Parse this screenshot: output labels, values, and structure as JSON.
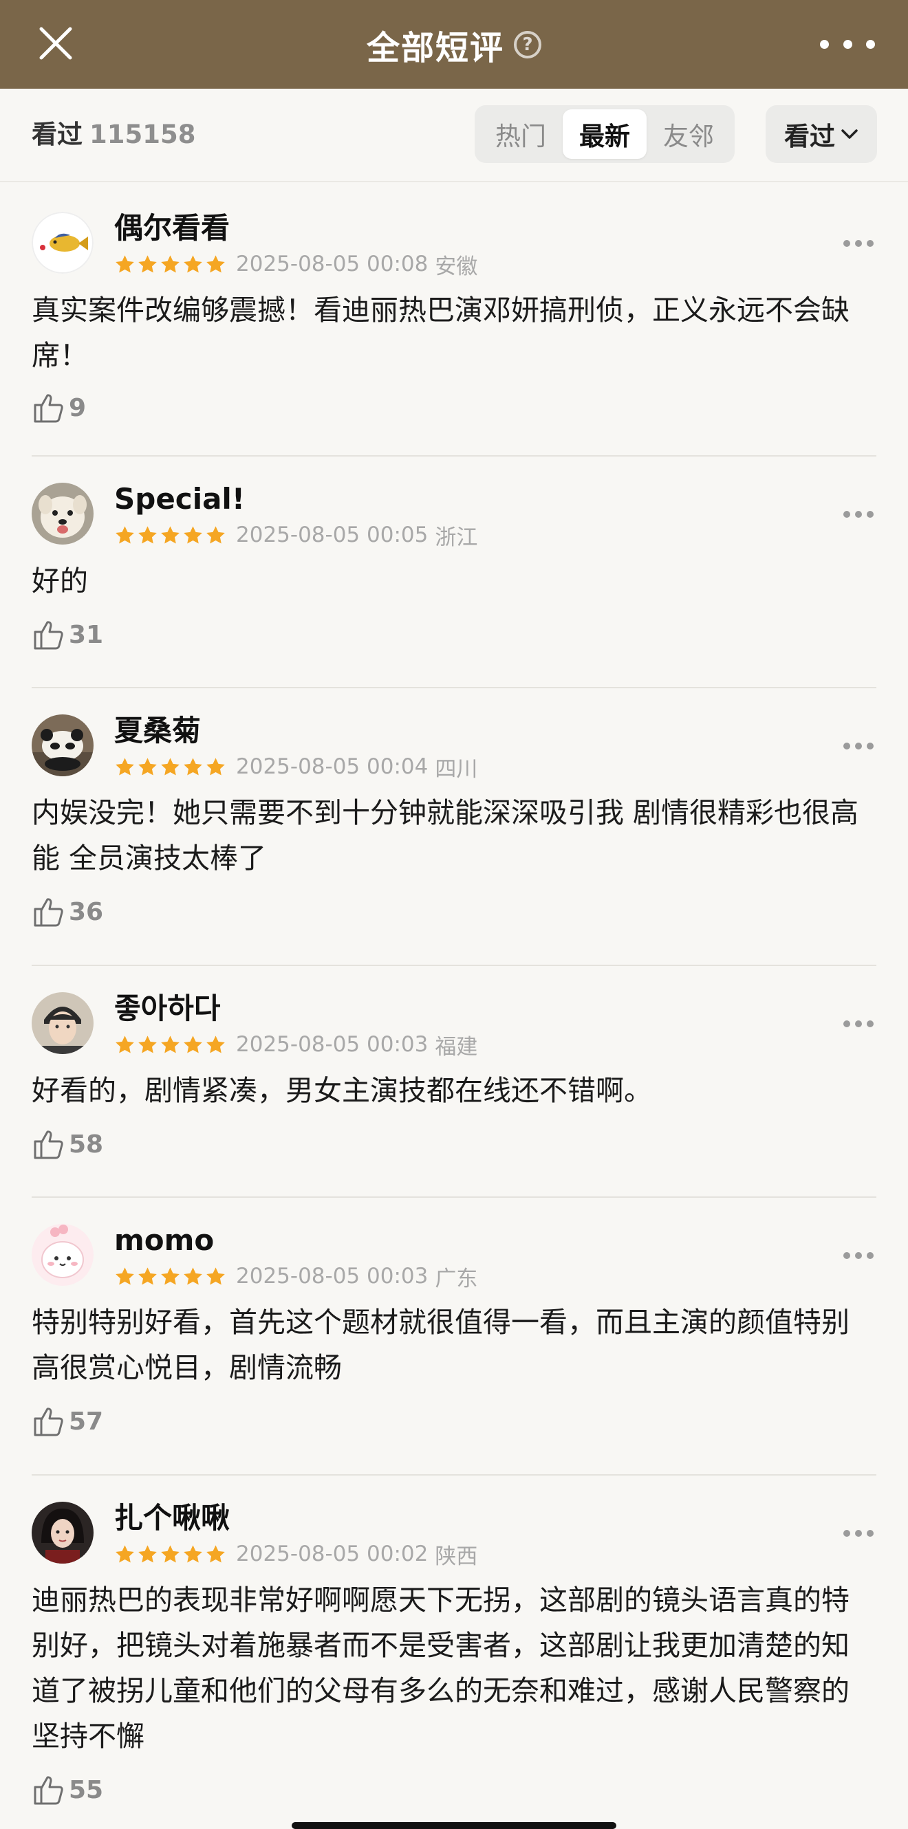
{
  "header": {
    "title": "全部短评",
    "help_glyph": "?",
    "close_icon": "close-icon",
    "more_icon": "more-horizontal-icon"
  },
  "filter": {
    "seen_label": "看过",
    "seen_count": "115158",
    "tabs": [
      {
        "label": "热门",
        "active": false
      },
      {
        "label": "最新",
        "active": true
      },
      {
        "label": "友邻",
        "active": false
      }
    ],
    "dropdown_label": "看过",
    "dropdown_icon": "chevron-down-icon"
  },
  "colors": {
    "header_bg": "#7a6649",
    "star": "#f5a623",
    "background": "#f8f7f4"
  },
  "comments": [
    {
      "user": "偶尔看看",
      "rating": 5,
      "date": "2025-08-05 00:08",
      "location": "安徽",
      "text": "真实案件改编够震撼！看迪丽热巴演邓妍搞刑侦，正义永远不会缺席！",
      "likes": "9",
      "avatar_icon": "fish-avatar"
    },
    {
      "user": "Special!",
      "rating": 5,
      "date": "2025-08-05 00:05",
      "location": "浙江",
      "text": "好的",
      "likes": "31",
      "avatar_icon": "dog-avatar"
    },
    {
      "user": "夏桑菊",
      "rating": 5,
      "date": "2025-08-05 00:04",
      "location": "四川",
      "text": "内娱没完！她只需要不到十分钟就能深深吸引我 剧情很精彩也很高能 全员演技太棒了",
      "likes": "36",
      "avatar_icon": "panda-avatar"
    },
    {
      "user": "좋아하다",
      "rating": 5,
      "date": "2025-08-05 00:03",
      "location": "福建",
      "text": "好看的，剧情紧凑，男女主演技都在线还不错啊。",
      "likes": "58",
      "avatar_icon": "person-avatar"
    },
    {
      "user": "momo",
      "rating": 5,
      "date": "2025-08-05 00:03",
      "location": "广东",
      "text": "特别特别好看，首先这个题材就很值得一看，而且主演的颜值特别高很赏心悦目，剧情流畅",
      "likes": "57",
      "avatar_icon": "cartoon-avatar"
    },
    {
      "user": "扎个啾啾",
      "rating": 5,
      "date": "2025-08-05 00:02",
      "location": "陕西",
      "text": "迪丽热巴的表现非常好啊啊愿天下无拐，这部剧的镜头语言真的特别好，把镜头对着施暴者而不是受害者，这部剧让我更加清楚的知道了被拐儿童和他们的父母有多么的无奈和难过，感谢人民警察的坚持不懈",
      "likes": "55",
      "avatar_icon": "girl-avatar"
    }
  ]
}
